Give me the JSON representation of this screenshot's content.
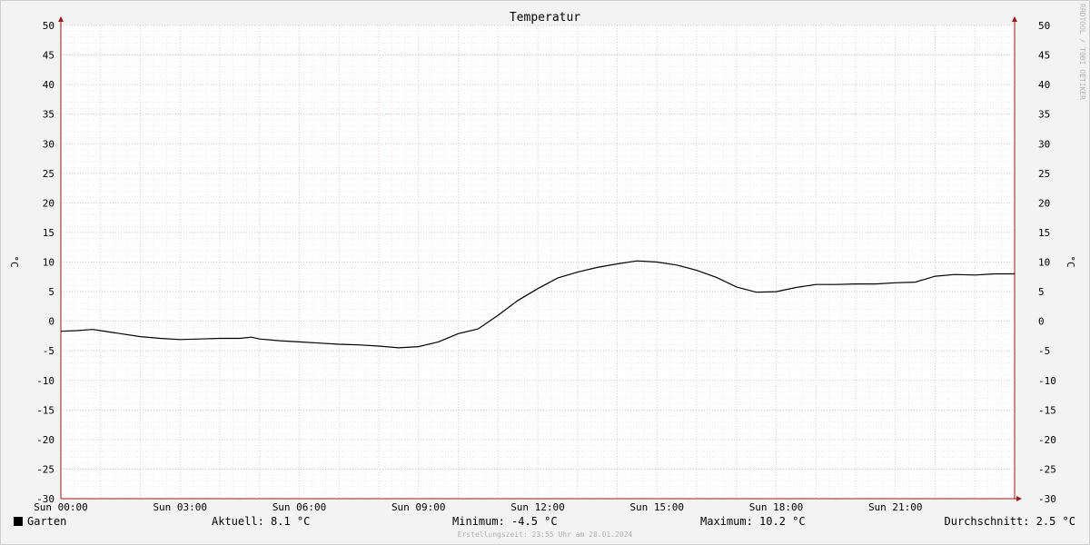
{
  "chart_data": {
    "type": "line",
    "title": "Temperatur",
    "ylabel": "°C",
    "ylim": [
      -30,
      50
    ],
    "yticks": [
      -30,
      -25,
      -20,
      -15,
      -10,
      -5,
      0,
      5,
      10,
      15,
      20,
      25,
      30,
      35,
      40,
      45,
      50
    ],
    "xlim": [
      0,
      24
    ],
    "xticks": [
      {
        "hour": 0,
        "label": "Sun 00:00"
      },
      {
        "hour": 3,
        "label": "Sun 03:00"
      },
      {
        "hour": 6,
        "label": "Sun 06:00"
      },
      {
        "hour": 9,
        "label": "Sun 09:00"
      },
      {
        "hour": 12,
        "label": "Sun 12:00"
      },
      {
        "hour": 15,
        "label": "Sun 15:00"
      },
      {
        "hour": 18,
        "label": "Sun 18:00"
      },
      {
        "hour": 21,
        "label": "Sun 21:00"
      }
    ],
    "grid": true,
    "series": [
      {
        "name": "Garten",
        "color": "#000000",
        "x": [
          0,
          0.4,
          0.8,
          1.0,
          1.5,
          2.0,
          2.5,
          3.0,
          3.5,
          4.0,
          4.5,
          4.8,
          5.0,
          5.5,
          6.0,
          6.5,
          7.0,
          7.5,
          8.0,
          8.5,
          9.0,
          9.5,
          10.0,
          10.5,
          11.0,
          11.5,
          12.0,
          12.5,
          13.0,
          13.5,
          14.0,
          14.5,
          15.0,
          15.5,
          16.0,
          16.5,
          17.0,
          17.5,
          18.0,
          18.5,
          19.0,
          19.5,
          20.0,
          20.5,
          21.0,
          21.5,
          22.0,
          22.5,
          23.0,
          23.5,
          24.0
        ],
        "y": [
          -1.7,
          -1.6,
          -1.4,
          -1.6,
          -2.1,
          -2.6,
          -2.9,
          -3.1,
          -3.0,
          -2.9,
          -2.9,
          -2.7,
          -3.0,
          -3.3,
          -3.5,
          -3.7,
          -3.9,
          -4.0,
          -4.2,
          -4.5,
          -4.3,
          -3.5,
          -2.1,
          -1.3,
          1.0,
          3.5,
          5.5,
          7.3,
          8.3,
          9.1,
          9.7,
          10.2,
          10.0,
          9.5,
          8.6,
          7.4,
          5.8,
          4.9,
          5.0,
          5.7,
          6.2,
          6.2,
          6.3,
          6.3,
          6.5,
          6.6,
          7.6,
          7.9,
          7.8,
          8.0,
          8.0
        ]
      }
    ]
  },
  "legend": {
    "series_label": "Garten",
    "aktuell": "Aktuell: 8.1 °C",
    "minimum": "Minimum: -4.5 °C",
    "maximum": "Maximum: 10.2 °C",
    "durchschnitt": "Durchschnitt: 2.5 °C"
  },
  "footer": "Erstellungszeit: 23:55 Uhr am 28.01.2024",
  "watermark": "RRDTOOL / TOBI OETIKER"
}
